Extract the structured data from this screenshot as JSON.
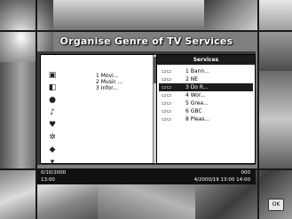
{
  "title": "Organise Genre of TV Services",
  "genres": {
    "icons": [
      "tv-icon",
      "movie-icon",
      "globe-icon",
      "music-icon",
      "kids-icon",
      "sports-icon",
      "news-icon",
      "other-icon"
    ],
    "items": [
      "1 Movi...",
      "2 Music ...",
      "3 Infor..."
    ]
  },
  "services": {
    "header": "Services",
    "selected_index": 2,
    "items": [
      {
        "icon": "tv-icon",
        "name": "1 Bann..."
      },
      {
        "icon": "tv-icon",
        "name": "2 NE"
      },
      {
        "icon": "tv-icon",
        "name": "3 Do R..."
      },
      {
        "icon": "tv-icon",
        "name": "4 Wor..."
      },
      {
        "icon": "tv-icon",
        "name": "5 Grea..."
      },
      {
        "icon": "tv-icon",
        "name": "6 GBC"
      },
      {
        "icon": "tv-icon",
        "name": "8 Pleas..."
      }
    ]
  },
  "status": {
    "left_line1": "0/10/2000",
    "left_line2": "13:00",
    "right_line1": "000",
    "right_line2": "4/2000/19 13:00 14:00"
  },
  "corner_button": "OK"
}
